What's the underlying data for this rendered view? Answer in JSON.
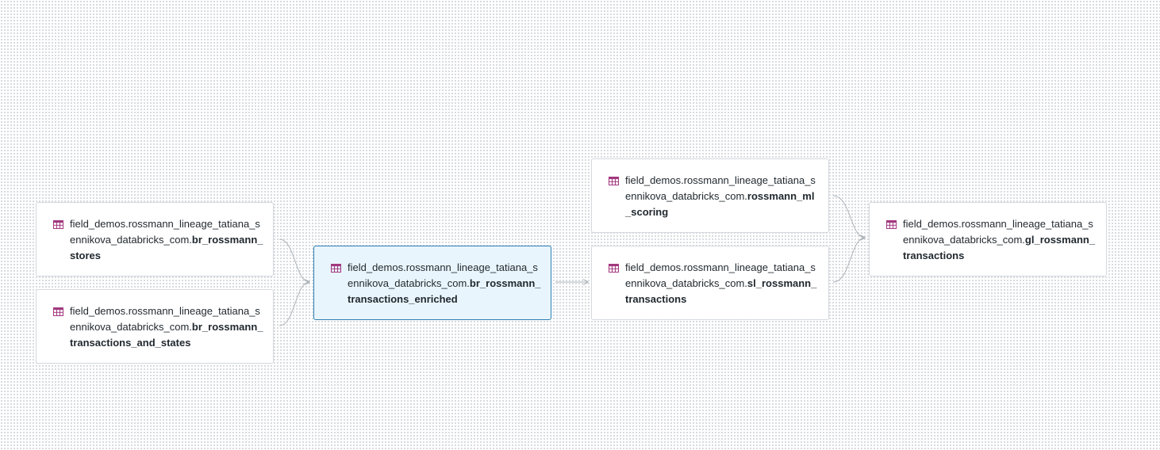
{
  "lineage_graph": {
    "nodes": [
      {
        "prefix": "field_demos.rossmann_lineage_tatiana_sennikova_databricks_com.",
        "name": "br_rossmann_stores",
        "icon": "table-icon",
        "selected": false
      },
      {
        "prefix": "field_demos.rossmann_lineage_tatiana_sennikova_databricks_com.",
        "name": "br_rossmann_transactions_and_states",
        "icon": "table-icon",
        "selected": false
      },
      {
        "prefix": "field_demos.rossmann_lineage_tatiana_sennikova_databricks_com.",
        "name": "br_rossmann_transactions_enriched",
        "icon": "table-icon",
        "selected": true
      },
      {
        "prefix": "field_demos.rossmann_lineage_tatiana_sennikova_databricks_com.",
        "name": "rossmann_ml_scoring",
        "icon": "table-icon",
        "selected": false
      },
      {
        "prefix": "field_demos.rossmann_lineage_tatiana_sennikova_databricks_com.",
        "name": "sl_rossmann_transactions",
        "icon": "table-icon",
        "selected": false
      },
      {
        "prefix": "field_demos.rossmann_lineage_tatiana_sennikova_databricks_com.",
        "name": "gl_rossmann_transactions",
        "icon": "table-icon",
        "selected": false
      }
    ],
    "edges": [
      {
        "from": "br_rossmann_stores",
        "to": "br_rossmann_transactions_enriched"
      },
      {
        "from": "br_rossmann_transactions_and_states",
        "to": "br_rossmann_transactions_enriched"
      },
      {
        "from": "br_rossmann_transactions_enriched",
        "to": "sl_rossmann_transactions"
      },
      {
        "from": "rossmann_ml_scoring",
        "to": "gl_rossmann_transactions"
      },
      {
        "from": "sl_rossmann_transactions",
        "to": "gl_rossmann_transactions"
      }
    ]
  },
  "colors": {
    "icon": "#a2387f",
    "edge": "#aeb4ba",
    "node_border": "#d4d9de",
    "selected_border": "#2a7fb4",
    "selected_bg": "#e9f5fc",
    "text": "#1f272d"
  }
}
